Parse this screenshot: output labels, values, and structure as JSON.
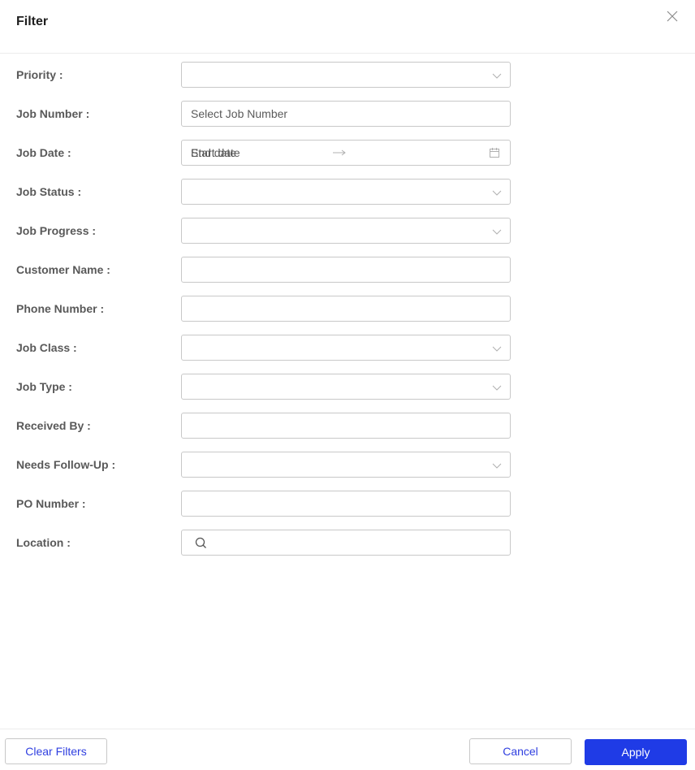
{
  "dialog": {
    "title": "Filter",
    "close_icon": "close-icon"
  },
  "form": {
    "fields": [
      {
        "label": "Priority :",
        "type": "select",
        "value": "",
        "icon": "chevron-down-icon"
      },
      {
        "label": "Job Number :",
        "type": "input",
        "value": "",
        "placeholder": "Select Job Number"
      },
      {
        "label": "Job Date :",
        "type": "daterange",
        "start_placeholder": "Start date",
        "end_placeholder": "End date",
        "separator_icon": "arrow-right-icon",
        "icon": "calendar-icon"
      },
      {
        "label": "Job Status :",
        "type": "select",
        "value": "",
        "icon": "chevron-down-icon"
      },
      {
        "label": "Job Progress :",
        "type": "select",
        "value": "",
        "icon": "chevron-down-icon"
      },
      {
        "label": "Customer Name :",
        "type": "input",
        "value": "",
        "placeholder": ""
      },
      {
        "label": "Phone Number :",
        "type": "input",
        "value": "",
        "placeholder": ""
      },
      {
        "label": "Job Class :",
        "type": "select",
        "value": "",
        "icon": "chevron-down-icon"
      },
      {
        "label": "Job Type :",
        "type": "select",
        "value": "",
        "icon": "chevron-down-icon"
      },
      {
        "label": "Received By :",
        "type": "input",
        "value": "",
        "placeholder": ""
      },
      {
        "label": "Needs Follow-Up :",
        "type": "select",
        "value": "",
        "icon": "chevron-down-icon"
      },
      {
        "label": "PO Number :",
        "type": "input",
        "value": "",
        "placeholder": ""
      },
      {
        "label": "Location :",
        "type": "search",
        "value": "",
        "placeholder": "",
        "icon": "search-icon"
      }
    ]
  },
  "footer": {
    "clear_label": "Clear Filters",
    "cancel_label": "Cancel",
    "apply_label": "Apply"
  },
  "colors": {
    "primary": "#1f3be6",
    "link_text": "#2f3fe0",
    "label_text": "#595959",
    "border": "#c8c8c8"
  }
}
